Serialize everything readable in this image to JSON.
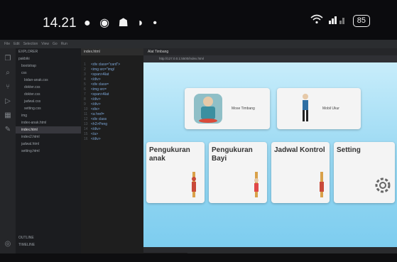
{
  "phone": {
    "time": "14.21",
    "status_icons": "● ◉ ☗ ◗ •",
    "battery": "85"
  },
  "ide": {
    "title_menu": [
      "File",
      "Edit",
      "Selection",
      "View",
      "Go",
      "Run"
    ],
    "explorer_header": "EXPLORER",
    "explorer_items": [
      "pakbiki",
      "bootstrap",
      "css",
      "bidan-anak.css",
      "dokter.css",
      "dokter.css",
      "jadwal.css",
      "setting.css",
      "img",
      "index-anak.html",
      "index.html",
      "index2.html",
      "jadwal.html",
      "setting.html"
    ],
    "explorer_footer": [
      "OUTLINE",
      "TIMELINE"
    ],
    "editor_tab": "index.html",
    "code_lines": [
      "<div class=\"card\">",
      "<img src=\"img/",
      "<span>Alat",
      "</div>",
      "<div class=",
      "<img src=",
      "<span>Alat",
      "</div>",
      "</div>",
      "<div>",
      "<a href=",
      "<div class",
      "<h2>Peng",
      "</div>",
      "</a>",
      "</div>"
    ],
    "preview_tab": "Alat Timbang",
    "address": "http://127.0.0.1:5500/index.html"
  },
  "app": {
    "cards": [
      {
        "label": "Mose Timbang",
        "icon": "scale-icon"
      },
      {
        "label": "Mobil Ukur",
        "icon": "measure-person-icon"
      },
      {
        "label": "Pengukuran anak",
        "icon": "child-height-icon"
      },
      {
        "label": "Pengukuran Bayi",
        "icon": "baby-height-icon"
      },
      {
        "label": "Jadwal Kontrol",
        "icon": "height-chart-icon"
      },
      {
        "label": "Setting",
        "icon": "gear-icon"
      }
    ]
  },
  "colors": {
    "app_bg_top": "#c8edfb",
    "app_bg_bottom": "#7dcdef",
    "card_bg": "#f4f4f4"
  }
}
